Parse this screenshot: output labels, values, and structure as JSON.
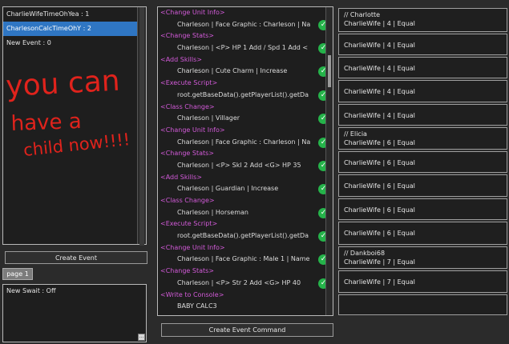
{
  "events": {
    "items": [
      "CharlieWifeTimeOhYea : 1",
      "CharlesonCalcTimeOhY : 2",
      "New Event : 0"
    ],
    "selected_index": 1
  },
  "buttons": {
    "create_event": "Create Event",
    "create_event_command": "Create Event Command"
  },
  "page_tab": "page 1",
  "switch_box": {
    "text": "New Swait : Off",
    "grip": "..."
  },
  "scribble_text": [
    "you can",
    "have a",
    "child now!!!!"
  ],
  "check_icon": "✓",
  "commands": [
    {
      "type": "header",
      "text": "<Change Unit Info>"
    },
    {
      "type": "detail",
      "text": "Charleson | Face Graphic : Charleson | Na",
      "check": true
    },
    {
      "type": "header",
      "text": "<Change Stats>"
    },
    {
      "type": "detail",
      "text": "Charleson | <P> HP 1 Add / Spd 1 Add <",
      "check": true
    },
    {
      "type": "header",
      "text": "<Add Skills>"
    },
    {
      "type": "detail",
      "text": "Charleson | Cute Charm | Increase",
      "check": true
    },
    {
      "type": "header",
      "text": "<Execute Script>"
    },
    {
      "type": "detail",
      "text": "root.getBaseData().getPlayerList().getDa",
      "check": true
    },
    {
      "type": "header",
      "text": "<Class Change>"
    },
    {
      "type": "detail",
      "text": "Charleson | Villager",
      "check": true
    },
    {
      "type": "header",
      "text": "<Change Unit Info>"
    },
    {
      "type": "detail",
      "text": "Charleson | Face Graphic : Charleson | Na",
      "check": true
    },
    {
      "type": "header",
      "text": "<Change Stats>"
    },
    {
      "type": "detail",
      "text": "Charleson | <P> Skl 2 Add <G> HP 35",
      "check": true
    },
    {
      "type": "header",
      "text": "<Add Skills>"
    },
    {
      "type": "detail",
      "text": "Charleson | Guardian | Increase",
      "check": true
    },
    {
      "type": "header",
      "text": "<Class Change>"
    },
    {
      "type": "detail",
      "text": "Charleson | Horseman",
      "check": true
    },
    {
      "type": "header",
      "text": "<Execute Script>"
    },
    {
      "type": "detail",
      "text": "root.getBaseData().getPlayerList().getDa",
      "check": true
    },
    {
      "type": "header",
      "text": "<Change Unit Info>"
    },
    {
      "type": "detail",
      "text": "Charleson | Face Graphic : Male 1 | Name",
      "check": true
    },
    {
      "type": "header",
      "text": "<Change Stats>"
    },
    {
      "type": "detail",
      "text": "Charleson | <P> Str 2 Add <G> HP 40",
      "check": true
    },
    {
      "type": "header",
      "text": "<Write to Console>"
    },
    {
      "type": "detail",
      "text": "BABY CALC3",
      "check": false
    }
  ],
  "conditions": [
    {
      "header": "// Charlotte",
      "text": "CharlieWife | 4 | Equal"
    },
    {
      "header": "",
      "text": "CharlieWife | 4 | Equal"
    },
    {
      "header": "",
      "text": "CharlieWife | 4 | Equal"
    },
    {
      "header": "",
      "text": "CharlieWife | 4 | Equal"
    },
    {
      "header": "",
      "text": "CharlieWife | 4 | Equal"
    },
    {
      "header": "// Elicia",
      "text": "CharlieWife | 6 | Equal"
    },
    {
      "header": "",
      "text": "CharlieWife | 6 | Equal"
    },
    {
      "header": "",
      "text": "CharlieWife | 6 | Equal"
    },
    {
      "header": "",
      "text": "CharlieWife | 6 | Equal"
    },
    {
      "header": "",
      "text": "CharlieWife | 6 | Equal"
    },
    {
      "header": "// Dankboi68",
      "text": "CharlieWife | 7 | Equal"
    },
    {
      "header": "",
      "text": "CharlieWife | 7 | Equal"
    },
    {
      "header": "",
      "text": ""
    }
  ],
  "colors": {
    "selection": "#2f76c3",
    "header": "#d25ad8",
    "check": "#25b34a",
    "scribble": "#e0231c"
  }
}
